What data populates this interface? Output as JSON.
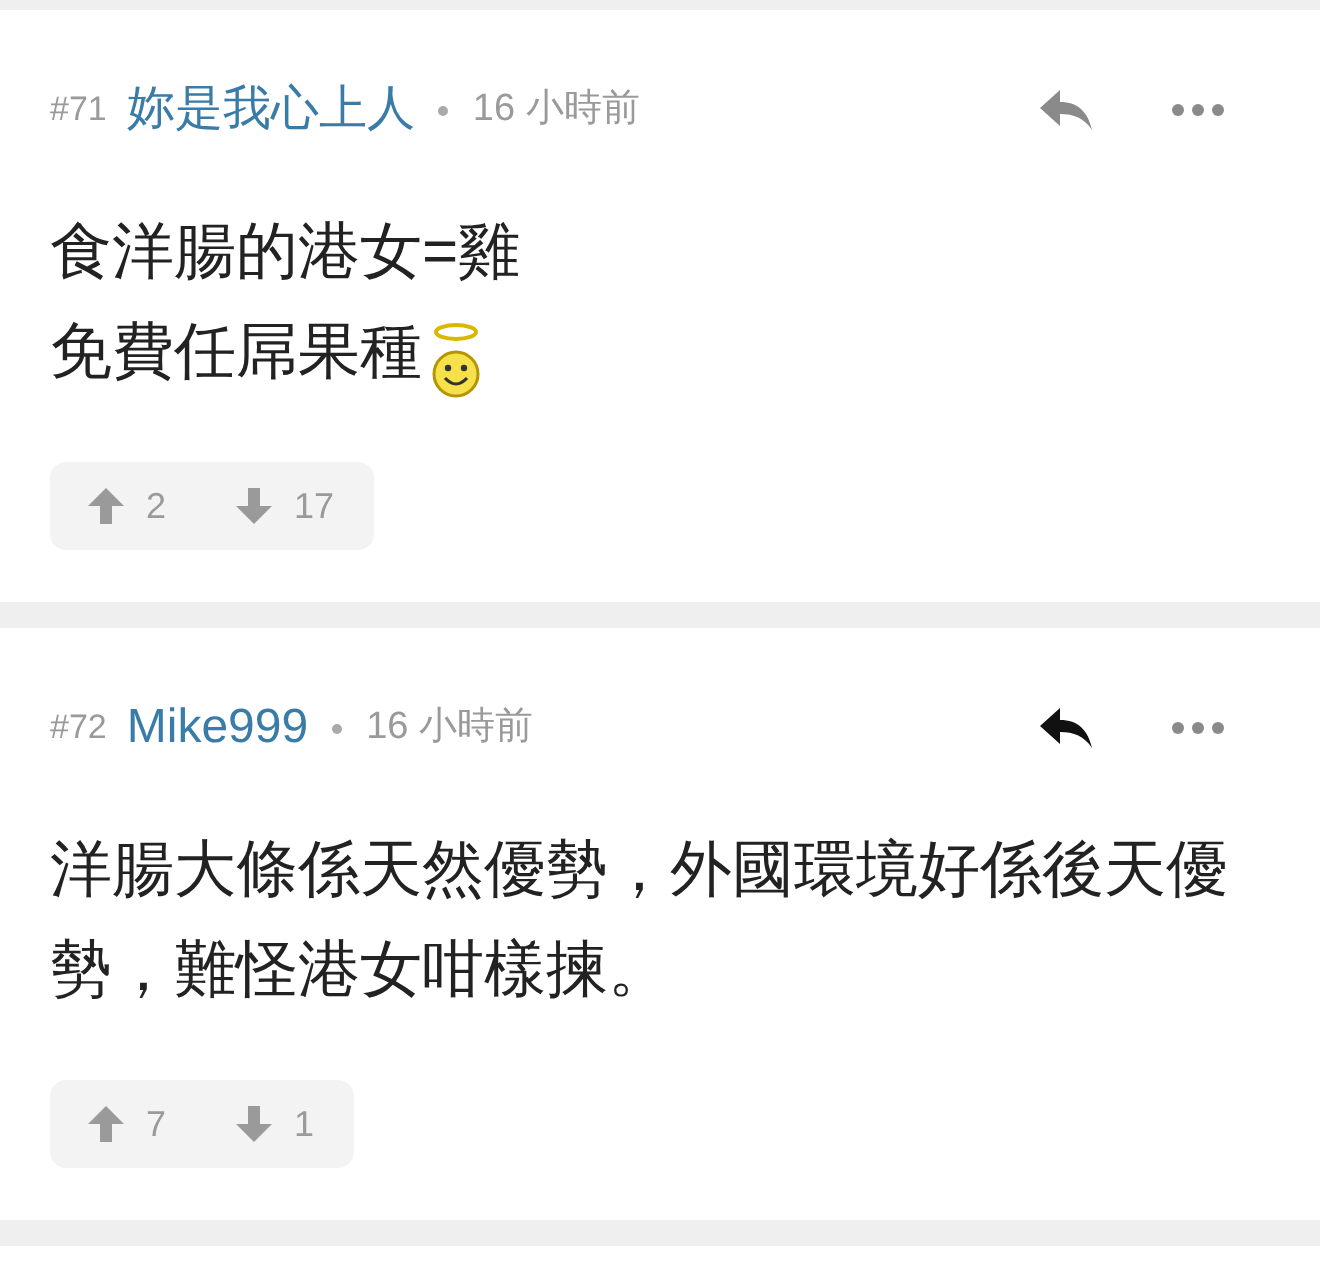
{
  "posts": [
    {
      "number": "#71",
      "author": "妳是我心上人",
      "time": "16 小時前",
      "reply_active": false,
      "lines": [
        {
          "text": "食洋腸的港女=雞",
          "kind": "plain"
        },
        {
          "text": "免費任屌果種",
          "kind": "smiley_end"
        }
      ],
      "upvotes": "2",
      "downvotes": "17"
    },
    {
      "number": "#72",
      "author": "Mike999",
      "time": "16 小時前",
      "reply_active": true,
      "lines": [
        {
          "text": "洋腸大條係天然優勢，外國環境好係後天優勢，難怪港女咁樣揀。",
          "kind": "plain"
        }
      ],
      "upvotes": "7",
      "downvotes": "1"
    }
  ]
}
